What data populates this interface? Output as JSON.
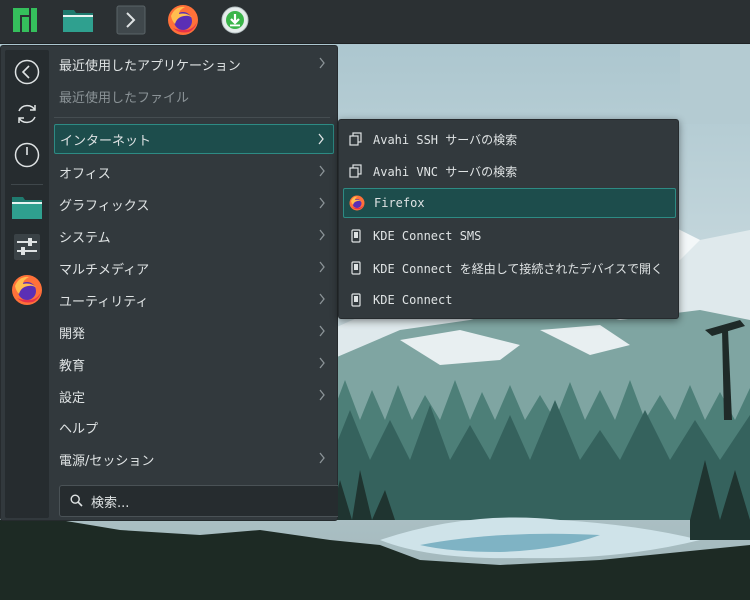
{
  "taskbar": {
    "items": [
      {
        "icon": "manjaro-logo-icon"
      },
      {
        "icon": "folder-icon"
      },
      {
        "icon": "terminal-icon"
      },
      {
        "icon": "firefox-icon"
      },
      {
        "icon": "download-icon"
      }
    ]
  },
  "sidebar": {
    "items": [
      {
        "icon": "back-icon"
      },
      {
        "icon": "refresh-icon"
      },
      {
        "icon": "power-icon"
      },
      {
        "icon": "folder-icon"
      },
      {
        "icon": "settings-sliders-icon"
      },
      {
        "icon": "firefox-icon"
      }
    ]
  },
  "menu": {
    "items": [
      {
        "label": "最近使用したアプリケーション",
        "has_submenu": true
      },
      {
        "label": "最近使用したファイル",
        "has_submenu": false,
        "disabled": true
      },
      {
        "label": "インターネット",
        "has_submenu": true,
        "active": true
      },
      {
        "label": "オフィス",
        "has_submenu": true
      },
      {
        "label": "グラフィックス",
        "has_submenu": true
      },
      {
        "label": "システム",
        "has_submenu": true
      },
      {
        "label": "マルチメディア",
        "has_submenu": true
      },
      {
        "label": "ユーティリティ",
        "has_submenu": true
      },
      {
        "label": "開発",
        "has_submenu": true
      },
      {
        "label": "教育",
        "has_submenu": true
      },
      {
        "label": "設定",
        "has_submenu": true
      },
      {
        "label": "ヘルプ",
        "has_submenu": false
      },
      {
        "label": "電源/セッション",
        "has_submenu": true
      }
    ]
  },
  "search": {
    "placeholder": "検索..."
  },
  "submenu": {
    "items": [
      {
        "label": "Avahi SSH サーバの検索",
        "icon": "network-server-icon"
      },
      {
        "label": "Avahi VNC サーバの検索",
        "icon": "network-server-icon"
      },
      {
        "label": "Firefox",
        "icon": "firefox-icon",
        "active": true
      },
      {
        "label": "KDE Connect SMS",
        "icon": "phone-icon"
      },
      {
        "label": "KDE Connect を経由して接続されたデバイスで開く",
        "icon": "phone-icon"
      },
      {
        "label": "KDE Connect",
        "icon": "phone-icon"
      }
    ]
  },
  "colors": {
    "accent": "#2d8b84",
    "active_bg": "#1d4d4c",
    "panel_bg": "#32393d",
    "text": "#dfe3e4"
  }
}
